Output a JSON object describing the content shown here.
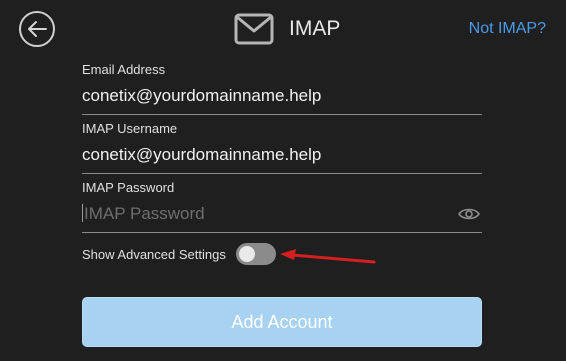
{
  "header": {
    "title": "IMAP",
    "not_imap_link": "Not IMAP?",
    "back_icon": "arrow-left-icon",
    "mail_icon": "envelope-icon"
  },
  "fields": {
    "email": {
      "label": "Email Address",
      "value": "conetix@yourdomainname.help"
    },
    "username": {
      "label": "IMAP Username",
      "value": "conetix@yourdomainname.help"
    },
    "password": {
      "label": "IMAP Password",
      "value": "",
      "placeholder": "IMAP Password",
      "eye_icon": "eye-icon"
    }
  },
  "advanced": {
    "label": "Show Advanced Settings",
    "enabled": false
  },
  "annotation": {
    "arrow_color": "#d21f1f"
  },
  "actions": {
    "add_account": "Add Account"
  },
  "colors": {
    "accent": "#4a9bea",
    "button": "#a8d2f1",
    "background": "#1f1f1f"
  }
}
